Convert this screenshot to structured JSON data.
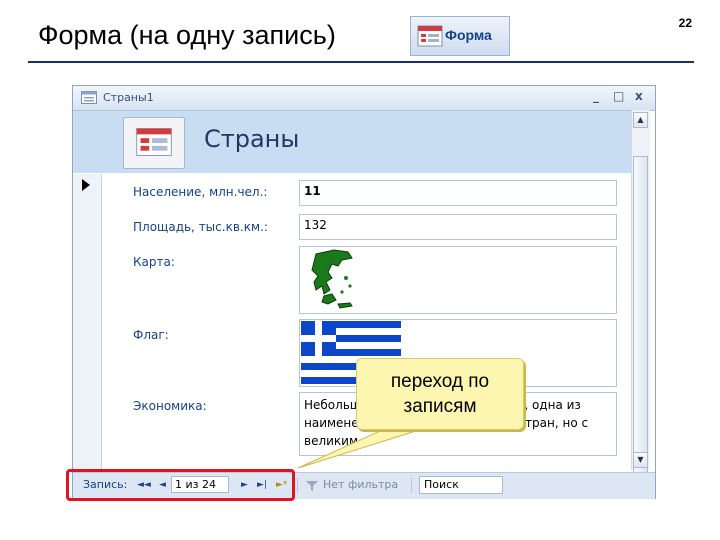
{
  "slide": {
    "title": "Форма (на одну запись)",
    "number": "22",
    "ribbon_button_label": "Форма",
    "ribbon_button_icon": "form-icon"
  },
  "window": {
    "title": "Страны1",
    "header_title": "Страны",
    "controls": {
      "minimize": "_",
      "restore": "□",
      "close": "x"
    }
  },
  "fields": [
    {
      "label": "Население, млн.чел.:",
      "value": "11"
    },
    {
      "label": "Площадь, тыс.кв.км.:",
      "value": "132"
    },
    {
      "label": "Карта:",
      "value": ""
    },
    {
      "label": "Флаг:",
      "value": ""
    },
    {
      "label": "Экономика:",
      "value": "Небольшая страна Южной Европы, одна из наименее развитых европейских стран, но с великим"
    }
  ],
  "navigation": {
    "record_label": "Запись:",
    "first": "◄◄",
    "prev": "◄",
    "current": "1 из 24",
    "next": "►",
    "last": "►|",
    "new": "►*",
    "filter_label": "Нет фильтра",
    "search_label": "Поиск"
  },
  "callout": {
    "line1": "переход по",
    "line2": "записям"
  },
  "colors": {
    "highlight": "#e0141c",
    "accent": "#15428b",
    "callout_bg": "#fdf6b0"
  }
}
